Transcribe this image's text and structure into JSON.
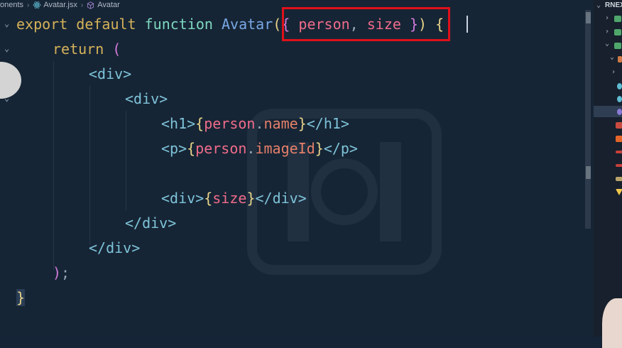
{
  "breadcrumb": {
    "part1": "onents",
    "part2": "Avatar.jsx",
    "part3": "Avatar"
  },
  "code": {
    "l1": {
      "export": "export",
      "default": "default",
      "function": "function",
      "name": "Avatar",
      "lparen": "(",
      "lbrace": "{",
      "p1": "person",
      "comma": ",",
      "p2": "size",
      "rbrace": "}",
      "rparen": ")",
      "open": "{"
    },
    "l2": {
      "return": "return",
      "paren": "("
    },
    "l3": {
      "tag": "<div>"
    },
    "l4": {
      "tag": "<div>"
    },
    "l5": {
      "open": "<h1>",
      "lb": "{",
      "obj": "person",
      "dot": ".",
      "prop": "name",
      "rb": "}",
      "close": "</h1>"
    },
    "l6": {
      "open": "<p>",
      "lb": "{",
      "obj": "person",
      "dot": ".",
      "prop": "imageId",
      "rb": "}",
      "close": "</p>"
    },
    "l8": {
      "open": "<div>",
      "lb": "{",
      "val": "size",
      "rb": "}",
      "close": "</div>"
    },
    "l9": {
      "tag": "</div>"
    },
    "l10": {
      "tag": "</div>"
    },
    "l11": {
      "paren": ")",
      "semi": ";"
    },
    "l12": {
      "brace": "}"
    }
  },
  "explorer": {
    "title": "RNEX"
  },
  "colors": {
    "highlight": "#e0101a",
    "background": "#162535"
  }
}
